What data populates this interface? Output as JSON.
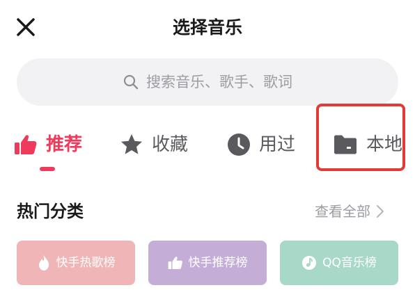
{
  "header": {
    "title": "选择音乐",
    "close_icon": "close-icon"
  },
  "search": {
    "placeholder": "搜索音乐、歌手、歌词",
    "icon": "search-icon"
  },
  "tabs": [
    {
      "label": "推荐",
      "icon": "thumbs-up-icon",
      "active": true
    },
    {
      "label": "收藏",
      "icon": "star-icon",
      "active": false
    },
    {
      "label": "用过",
      "icon": "clock-icon",
      "active": false
    },
    {
      "label": "本地",
      "icon": "folder-icon",
      "active": false
    }
  ],
  "section": {
    "title": "热门分类",
    "view_all": "查看全部"
  },
  "categories": [
    {
      "label": "快手热歌榜",
      "icon": "flame-icon",
      "color": "#f0b5b7"
    },
    {
      "label": "快手推荐榜",
      "icon": "thumbs-up-icon",
      "color": "#c4aed8"
    },
    {
      "label": "QQ音乐榜",
      "icon": "music-note-icon",
      "color": "#a8d8c8"
    }
  ],
  "colors": {
    "accent": "#ef3a5c",
    "highlight_border": "#e53935",
    "muted_text": "#9c9ca3",
    "tab_icon": "#59595e"
  }
}
